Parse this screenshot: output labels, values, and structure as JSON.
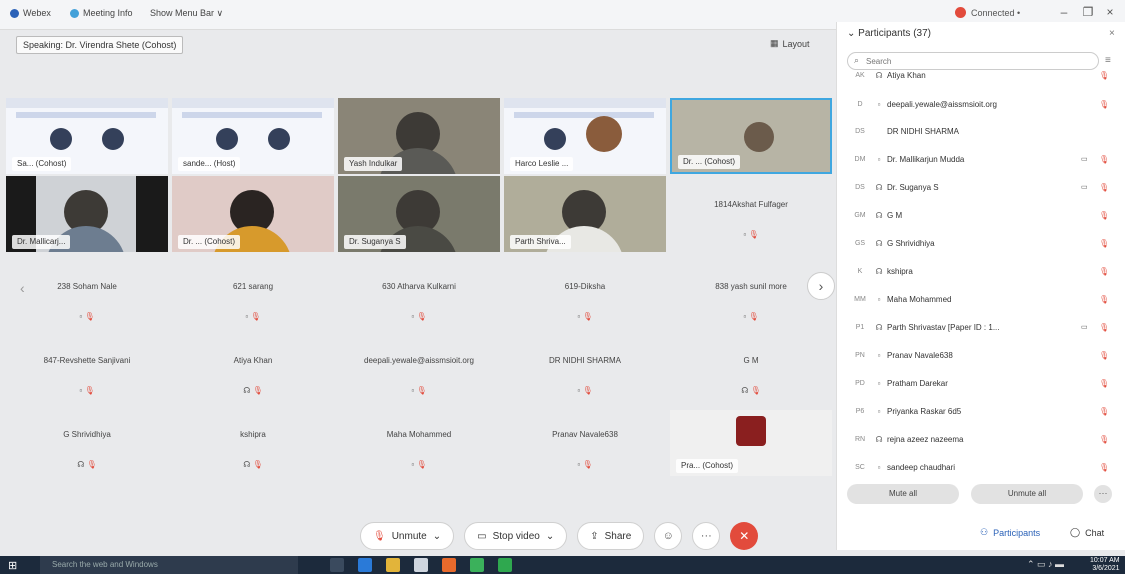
{
  "menubar": {
    "app": "Webex",
    "meeting_info": "Meeting Info",
    "show_menu_bar": "Show Menu Bar ∨",
    "status": "Connected •",
    "min": "–",
    "restore": "❐",
    "close": "×"
  },
  "speaking": "Speaking: Dr. Virendra Shete (Cohost)",
  "layout": "Layout",
  "video_tiles": [
    {
      "label": "Sa...  (Cohost)"
    },
    {
      "label": "sande...  (Host)"
    },
    {
      "label": "Yash Indulkar"
    },
    {
      "label": "Harco Leslie ..."
    },
    {
      "label": "Dr. ...  (Cohost)"
    },
    {
      "label": "Dr. Mallicarj..."
    },
    {
      "label": "Dr. ...  (Cohost)"
    },
    {
      "label": "Dr. Suganya S"
    },
    {
      "label": "Parth Shriva..."
    }
  ],
  "name_tiles": [
    "1814Akshat Fulfager",
    "238 Soham Nale",
    "621 sarang",
    "630 Atharva Kulkarni",
    "619-Diksha",
    "838 yash sunil more",
    "847-Revshette Sanjivani",
    "Atiya Khan",
    "deepali.yewale@aissmsioit.org",
    "DR NIDHI SHARMA",
    "G M",
    "G Shrividhiya",
    "kshipra",
    "Maha Mohammed",
    "Pranav Navale638"
  ],
  "last_tile_label": "Pra...  (Cohost)",
  "controls": {
    "unmute": "Unmute",
    "stop_video": "Stop video",
    "share": "Share"
  },
  "panel": {
    "title": "Participants (37)",
    "search_placeholder": "Search",
    "rows": [
      {
        "initials": "AK",
        "name": "Atiya Khan"
      },
      {
        "initials": "D",
        "name": "deepali.yewale@aissmsioit.org"
      },
      {
        "initials": "DS",
        "name": "DR NIDHI SHARMA"
      },
      {
        "initials": "DM",
        "name": "Dr. Mallikarjun Mudda"
      },
      {
        "initials": "DS",
        "name": "Dr. Suganya S"
      },
      {
        "initials": "GM",
        "name": "G M"
      },
      {
        "initials": "GS",
        "name": "G Shrividhiya"
      },
      {
        "initials": "K",
        "name": "kshipra"
      },
      {
        "initials": "MM",
        "name": "Maha Mohammed"
      },
      {
        "initials": "P1",
        "name": "Parth Shrivastav [Paper ID : 1..."
      },
      {
        "initials": "PN",
        "name": "Pranav Navale638"
      },
      {
        "initials": "PD",
        "name": "Pratham Darekar"
      },
      {
        "initials": "P6",
        "name": "Priyanka Raskar 6d5"
      },
      {
        "initials": "RN",
        "name": "rejna azeez nazeema"
      },
      {
        "initials": "SC",
        "name": "sandeep chaudhari"
      }
    ],
    "mute_all": "Mute all",
    "unmute_all": "Unmute all",
    "participants_btn": "Participants",
    "chat_btn": "Chat"
  },
  "taskbar": {
    "search": "Search the web and Windows",
    "time": "10:07 AM",
    "date": "3/6/2021"
  },
  "colors": {
    "accent": "#2b62b8",
    "end": "#e24b3c",
    "taskbar": "#1c2a3c"
  }
}
